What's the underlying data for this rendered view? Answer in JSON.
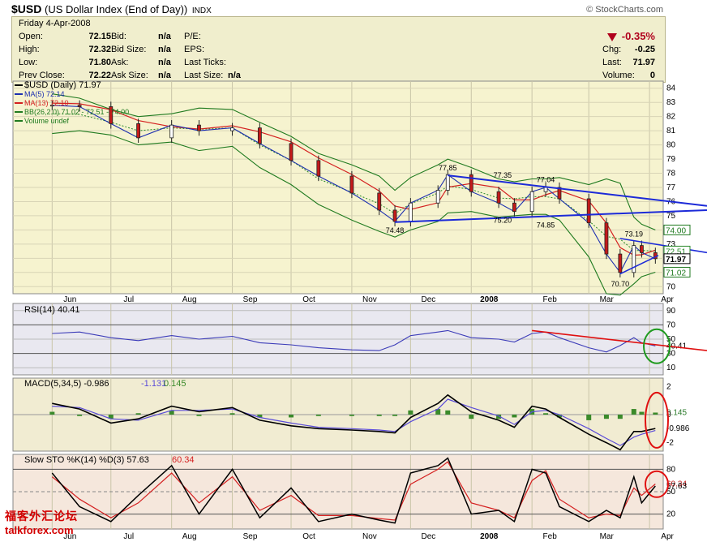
{
  "header": {
    "symbol": "$USD",
    "name": "(US Dollar Index (End of Day))",
    "index_tag": "INDX",
    "brand": "© StockCharts.com"
  },
  "quote": {
    "date": "Friday   4-Apr-2008",
    "left": [
      {
        "label": "Open:",
        "value": "72.15"
      },
      {
        "label": "High:",
        "value": "72.32"
      },
      {
        "label": "Low:",
        "value": "71.80"
      },
      {
        "label": "Prev Close:",
        "value": "72.22"
      }
    ],
    "mid": [
      {
        "label": "Bid:",
        "value": "n/a"
      },
      {
        "label": "Bid Size:",
        "value": "n/a"
      },
      {
        "label": "Ask:",
        "value": "n/a"
      },
      {
        "label": "Ask Size:",
        "value": "n/a"
      }
    ],
    "right": [
      {
        "label": "P/E:",
        "value": ""
      },
      {
        "label": "EPS:",
        "value": ""
      },
      {
        "label": "Last Ticks:",
        "value": ""
      },
      {
        "label": "Last Size:",
        "value": "n/a"
      }
    ],
    "change_pct": "-0.35%",
    "rk": [
      {
        "label": "Chg:",
        "value": "-0.25"
      },
      {
        "label": "Last:",
        "value": "71.97"
      },
      {
        "label": "Volume:",
        "value": "0"
      }
    ]
  },
  "watermark": {
    "line1": "福客外汇论坛",
    "line2": "talkforex.com"
  },
  "chart_data": [
    {
      "type": "line",
      "panel": "price",
      "legend": [
        "$USD (Daily) 71.97",
        "MA(5) 72.14",
        "MA(13) 72.10",
        "BB(26,2.0) 71.02 - 72.51 - 74.00",
        "Volume undef"
      ],
      "colors": {
        "price": "#111111",
        "ma5": "#1c2fb0",
        "ma13": "#d42020",
        "bb": "#1f7a1f",
        "mid": "#2a8a2a",
        "bg": "#f6f3cf",
        "trend": "#1c2ad8"
      },
      "months": [
        "Jun",
        "Jul",
        "Aug",
        "Sep",
        "Oct",
        "Nov",
        "Dec",
        "2008",
        "Feb",
        "Mar",
        "Apr"
      ],
      "ylim": [
        69.5,
        84.5
      ],
      "yticks": [
        70,
        71,
        72,
        73,
        74,
        75,
        76,
        77,
        78,
        79,
        80,
        81,
        82,
        83,
        84
      ],
      "x": [
        "2007-06-01",
        "2007-06-15",
        "2007-07-01",
        "2007-07-15",
        "2007-08-01",
        "2007-08-15",
        "2007-09-01",
        "2007-09-15",
        "2007-10-01",
        "2007-10-15",
        "2007-11-01",
        "2007-11-15",
        "2007-11-23",
        "2007-12-01",
        "2007-12-15",
        "2007-12-20",
        "2008-01-01",
        "2008-01-15",
        "2008-01-23",
        "2008-02-01",
        "2008-02-08",
        "2008-02-15",
        "2008-03-01",
        "2008-03-10",
        "2008-03-17",
        "2008-03-24",
        "2008-03-28",
        "2008-04-04"
      ],
      "close": [
        82.8,
        82.7,
        81.5,
        80.5,
        81.4,
        81.0,
        81.2,
        80.1,
        78.9,
        77.8,
        76.6,
        75.4,
        74.6,
        75.9,
        76.8,
        77.9,
        76.7,
        75.9,
        75.3,
        76.7,
        77.0,
        76.2,
        74.5,
        72.3,
        71.0,
        72.9,
        72.4,
        71.97
      ],
      "bb_upper": [
        83.6,
        83.3,
        82.5,
        82.0,
        82.2,
        82.6,
        82.5,
        81.6,
        80.6,
        79.4,
        78.6,
        77.8,
        76.8,
        77.7,
        78.6,
        79.0,
        78.4,
        77.6,
        77.4,
        77.6,
        77.6,
        77.7,
        77.2,
        77.6,
        77.3,
        74.9,
        74.4,
        74.0
      ],
      "bb_lower": [
        80.8,
        81.0,
        80.7,
        80.0,
        80.2,
        79.6,
        79.9,
        78.4,
        77.2,
        75.8,
        74.7,
        73.9,
        73.5,
        74.0,
        74.6,
        75.2,
        75.3,
        74.9,
        75.0,
        75.1,
        75.1,
        74.7,
        72.1,
        69.5,
        69.4,
        70.2,
        70.7,
        71.02
      ],
      "annotations": [
        {
          "label": "77.85",
          "x": "2007-12-20",
          "y": 77.85
        },
        {
          "label": "77.35",
          "x": "2008-01-17",
          "y": 77.35
        },
        {
          "label": "77.04",
          "x": "2008-02-08",
          "y": 77.04
        },
        {
          "label": "74.48",
          "x": "2007-11-23",
          "y": 74.48
        },
        {
          "label": "75.20",
          "x": "2008-01-17",
          "y": 75.2
        },
        {
          "label": "74.85",
          "x": "2008-02-08",
          "y": 74.85
        },
        {
          "label": "73.19",
          "x": "2008-03-24",
          "y": 73.19
        },
        {
          "label": "70.70",
          "x": "2008-03-17",
          "y": 70.7
        }
      ],
      "right_labels": [
        "74.00",
        "72.51",
        "71.97",
        "71.02"
      ]
    },
    {
      "type": "line",
      "panel": "rsi",
      "legend": "RSI(14) 40.41",
      "ylim": [
        0,
        100
      ],
      "yticks": [
        10,
        30,
        50,
        70,
        90
      ],
      "right_labels": [
        "90",
        "70",
        "50",
        "40.41",
        "30",
        "10"
      ],
      "values": [
        58,
        60,
        52,
        48,
        55,
        50,
        54,
        45,
        42,
        38,
        35,
        34,
        42,
        55,
        60,
        62,
        52,
        50,
        46,
        58,
        60,
        52,
        38,
        32,
        41,
        52,
        45,
        40.41
      ]
    },
    {
      "type": "line",
      "panel": "macd",
      "legend": [
        "MACD(5,34,5) -0.986",
        "-1.131",
        "0.145"
      ],
      "ylim": [
        -2.6,
        2.6
      ],
      "yticks": [
        -2,
        0,
        2
      ],
      "right_labels": [
        "2",
        "0.145",
        "0",
        "-0.986",
        "-2"
      ],
      "macd": [
        0.8,
        0.4,
        -0.6,
        -0.3,
        0.6,
        0.2,
        0.5,
        -0.4,
        -0.8,
        -1.0,
        -1.1,
        -1.2,
        -1.3,
        -0.2,
        0.8,
        1.4,
        0.2,
        -0.4,
        -0.9,
        0.6,
        0.4,
        -0.2,
        -1.4,
        -2.0,
        -2.5,
        -1.2,
        -1.2,
        -0.986
      ],
      "signal": [
        0.6,
        0.5,
        -0.3,
        -0.4,
        0.3,
        0.3,
        0.4,
        -0.2,
        -0.6,
        -0.9,
        -1.0,
        -1.1,
        -1.2,
        -0.5,
        0.4,
        1.1,
        0.5,
        -0.1,
        -0.7,
        0.2,
        0.3,
        0.0,
        -1.0,
        -1.7,
        -2.2,
        -1.6,
        -1.4,
        -1.131
      ],
      "hist": [
        0.2,
        -0.1,
        -0.3,
        0.1,
        0.3,
        -0.1,
        0.1,
        -0.2,
        -0.2,
        -0.1,
        -0.1,
        -0.1,
        -0.1,
        0.3,
        0.4,
        0.3,
        -0.3,
        -0.3,
        -0.2,
        0.4,
        0.1,
        -0.2,
        -0.4,
        -0.3,
        -0.3,
        0.4,
        0.2,
        0.145
      ]
    },
    {
      "type": "line",
      "panel": "stochastic",
      "legend": [
        "Slow STO %K(14) %D(3) 57.63",
        "60.34"
      ],
      "ylim": [
        0,
        100
      ],
      "yticks": [
        20,
        50,
        80
      ],
      "right_labels": [
        "80",
        "60.34",
        "57.63",
        "50",
        "20"
      ],
      "k": [
        75,
        30,
        10,
        45,
        85,
        20,
        80,
        15,
        55,
        10,
        20,
        12,
        8,
        75,
        85,
        95,
        20,
        25,
        10,
        80,
        75,
        30,
        10,
        25,
        15,
        70,
        35,
        57.63
      ],
      "d": [
        70,
        40,
        15,
        35,
        75,
        35,
        70,
        25,
        45,
        18,
        18,
        14,
        12,
        60,
        80,
        90,
        35,
        25,
        15,
        65,
        78,
        40,
        15,
        20,
        18,
        55,
        45,
        60.34
      ]
    }
  ]
}
